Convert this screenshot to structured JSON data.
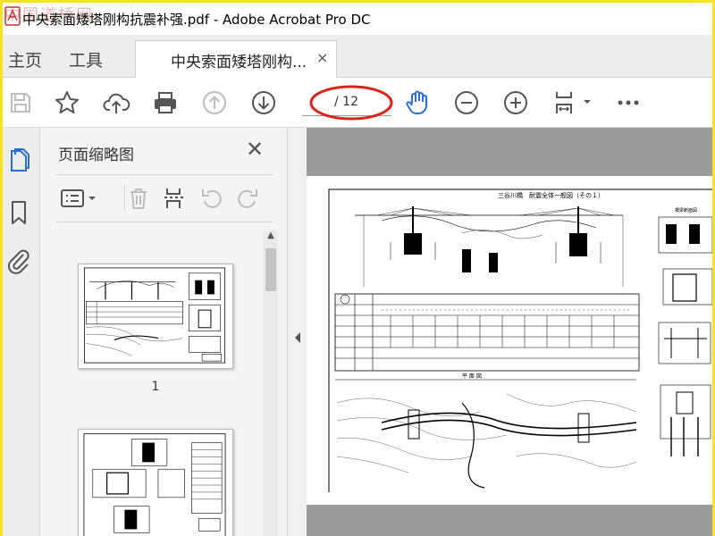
{
  "window": {
    "title": "中央索面矮塔刚构抗震补强.pdf - Adobe Acrobat Pro DC",
    "watermark": "中国道桥网"
  },
  "tabs": {
    "home": "主页",
    "tools": "工具",
    "document": "中央索面矮塔刚构...",
    "close_glyph": "×"
  },
  "toolbar": {
    "icons": [
      "save-icon",
      "star-icon",
      "upload-icon",
      "print-icon",
      "prev-page-icon",
      "next-page-icon",
      "hand-icon",
      "zoom-out-icon",
      "zoom-in-icon",
      "fit-page-icon",
      "more-icon"
    ],
    "page_count": "/ 12",
    "highlight_color": "#d9261c",
    "accent_color": "#2a6fd6"
  },
  "rail": {
    "icons": [
      "page-thumbnails-icon",
      "bookmark-icon",
      "attachment-icon"
    ]
  },
  "panel": {
    "title": "页面缩略图",
    "close_glyph": "✕",
    "tools": [
      "options-menu-icon",
      "delete-icon",
      "insert-page-icon",
      "rotate-ccw-icon",
      "rotate-cw-icon"
    ],
    "thumbnails": [
      {
        "label": "1"
      },
      {
        "label": ""
      }
    ]
  },
  "document": {
    "drawing_title": "三谷川橋　耐震全体一般図（その１）",
    "plan_label": "平 面 図",
    "right_label": "橋梁断面図"
  }
}
